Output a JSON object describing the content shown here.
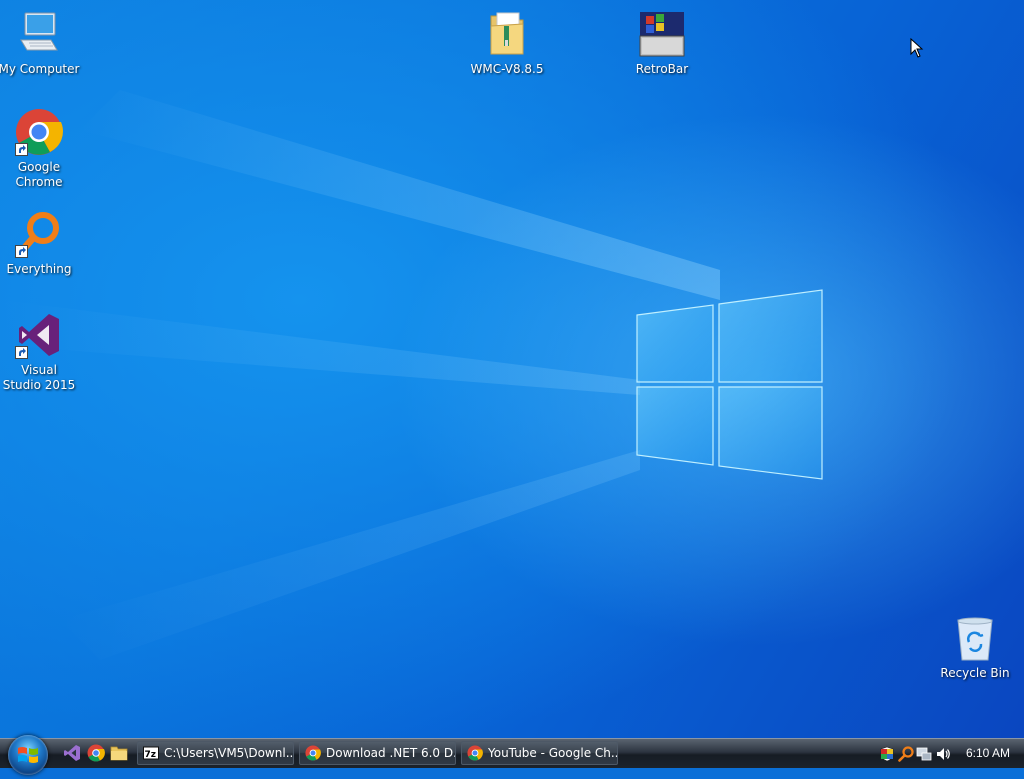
{
  "desktop": {
    "icons": [
      {
        "label": "My Computer"
      },
      {
        "label": "Google Chrome"
      },
      {
        "label": "Everything"
      },
      {
        "label": "Visual Studio 2015"
      },
      {
        "label": "WMC-V8.8.5"
      },
      {
        "label": "RetroBar"
      },
      {
        "label": "Recycle Bin"
      }
    ]
  },
  "taskbar": {
    "start_icon": "windows-orb-icon",
    "quick_launch": [
      "visual-studio-icon",
      "chrome-icon",
      "file-explorer-icon"
    ],
    "buttons": [
      {
        "label": "C:\\Users\\VM5\\Downl...",
        "icon": "7zip-icon"
      },
      {
        "label": "Download .NET 6.0 D...",
        "icon": "chrome-icon"
      },
      {
        "label": "YouTube - Google Ch...",
        "icon": "chrome-icon"
      }
    ],
    "tray": {
      "icons": [
        "security-shield-icon",
        "everything-search-icon",
        "network-icon",
        "volume-icon"
      ],
      "clock": "6:10 AM"
    }
  },
  "colors": {
    "wallpaper_blue": "#0a6fd8",
    "taskbar": "#1c232c"
  }
}
